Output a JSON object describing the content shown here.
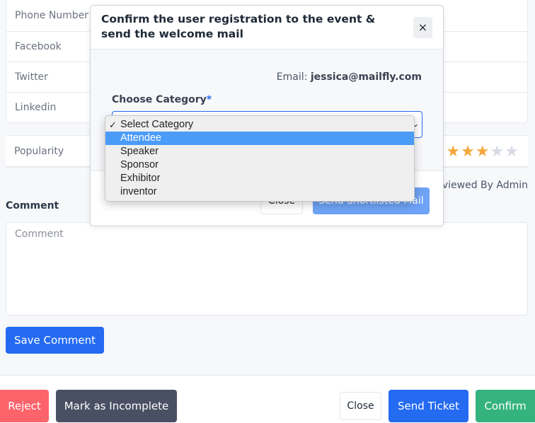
{
  "profile_fields": [
    {
      "label": "Phone Number"
    },
    {
      "label": "Facebook"
    },
    {
      "label": "Twitter"
    },
    {
      "label": "Linkedin"
    }
  ],
  "popularity": {
    "label": "Popularity",
    "rating": 3,
    "max_rating": 5,
    "stars": [
      "★",
      "★",
      "★",
      "★",
      "★"
    ]
  },
  "reviewed_by": "Reviewed By Admin",
  "comment": {
    "label": "Comment",
    "placeholder": "Comment",
    "value": "",
    "save_label": "Save Comment"
  },
  "footer": {
    "reject_label": "Reject",
    "incomplete_label": "Mark as Incomplete",
    "close_label": "Close",
    "send_ticket_label": "Send Ticket",
    "confirm_label": "Confirm"
  },
  "modal": {
    "title": "Confirm the user registration to the event & send the welcome mail",
    "close_icon": "×",
    "email_label": "Email:",
    "email_value": "jessica@mailfly.com",
    "category_label": "Choose Category",
    "required_marker": "*",
    "select_caret": "⌄",
    "selected_option": "Select Category",
    "close_label": "Close",
    "send_label": "Send Shortlisted Mail"
  },
  "dropdown": {
    "check_icon": "✓",
    "options": [
      "Select Category",
      "Attendee",
      "Speaker",
      "Sponsor",
      "Exhibitor",
      "inventor"
    ],
    "checked_index": 0,
    "highlighted_index": 1
  },
  "colors": {
    "primary": "#246bf2",
    "danger": "#fc636b",
    "dark": "#4a5064",
    "success": "#35b37e",
    "star_filled": "#f4a83d",
    "star_empty": "#d6dbe5",
    "highlight": "#4b9bf8"
  }
}
